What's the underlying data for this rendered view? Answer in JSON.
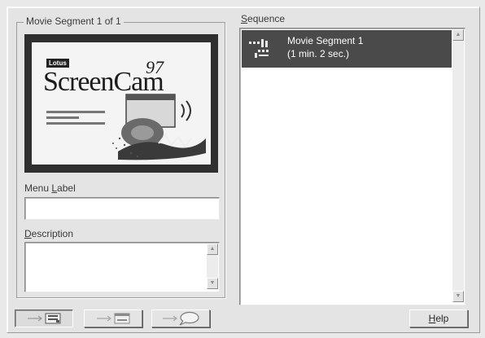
{
  "group": {
    "title": "Movie Segment 1 of 1"
  },
  "preview": {
    "badge": "Lotus",
    "title": "ScreenCam",
    "version": "97"
  },
  "menu_label": {
    "pre": "Menu ",
    "key": "L",
    "post": "abel",
    "value": ""
  },
  "description": {
    "pre": "",
    "key": "D",
    "post": "escription",
    "value": ""
  },
  "sequence": {
    "label_key": "S",
    "label_rest": "equence",
    "items": [
      {
        "title": "Movie Segment 1",
        "duration": "(1 min. 2 sec.)",
        "selected": true
      }
    ]
  },
  "toolbar": {
    "buttons": [
      {
        "icon": "segment-screen-icon",
        "pressed": true
      },
      {
        "icon": "segment-caption-icon",
        "pressed": false
      },
      {
        "icon": "segment-balloon-icon",
        "pressed": false
      }
    ],
    "help_key": "H",
    "help_rest": "elp"
  }
}
